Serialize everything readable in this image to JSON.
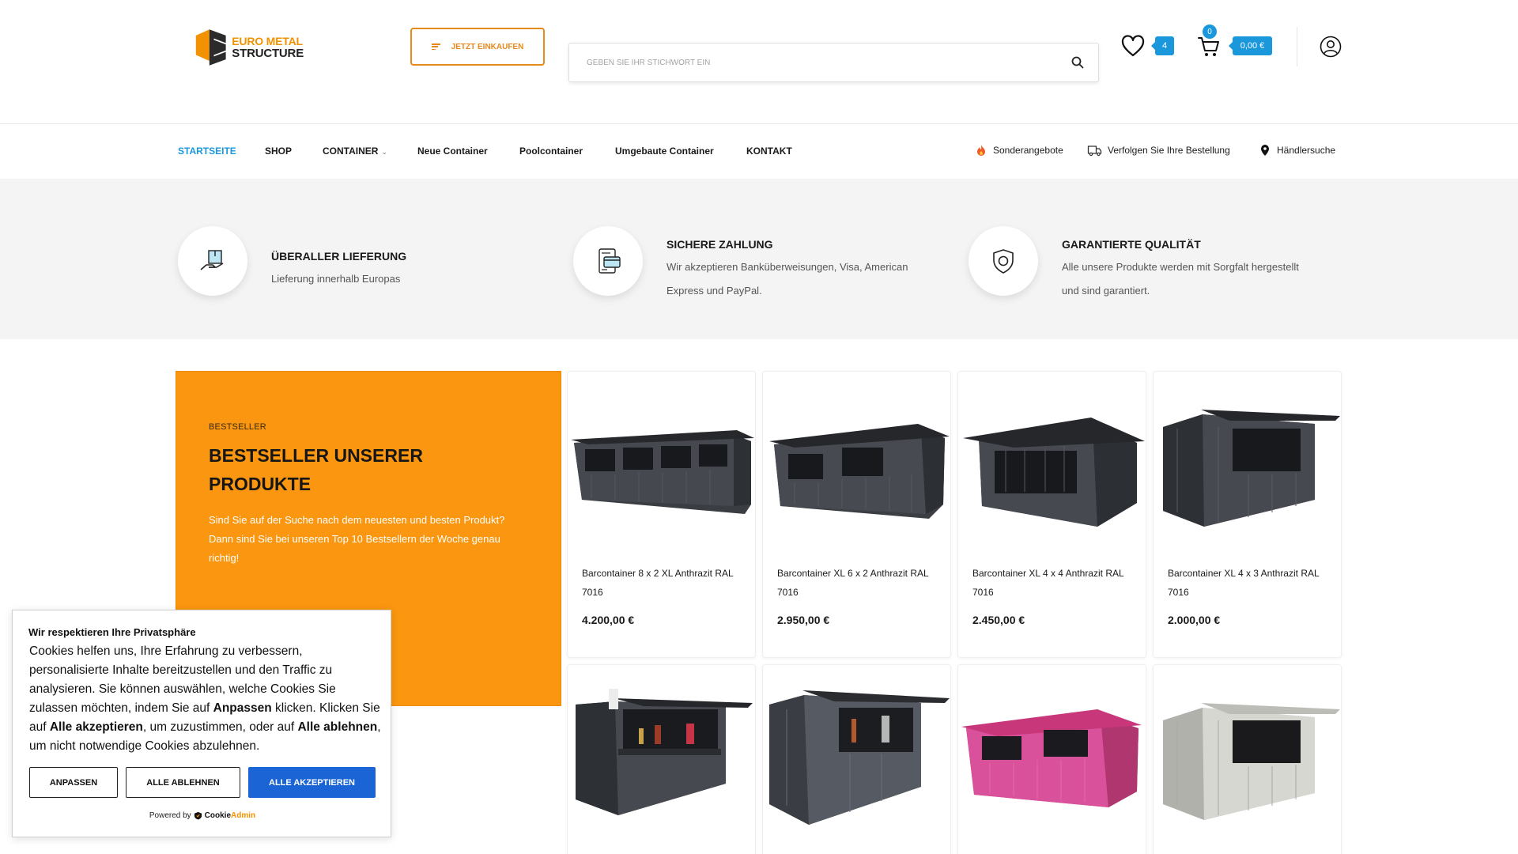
{
  "brand": {
    "line1_a": "EURO",
    "line1_b": "METAL",
    "line2": "STRUCTURE"
  },
  "header": {
    "shop_button": "JETZT EINKAUFEN",
    "search_placeholder": "GEBEN SIE IHR STICHWORT EIN",
    "wishlist_count": "4",
    "cart_count": "0",
    "cart_total": "0,00 €"
  },
  "nav": {
    "items": [
      {
        "label": "STARTSEITE"
      },
      {
        "label": "SHOP"
      },
      {
        "label": "CONTAINER"
      },
      {
        "label": "Neue Container"
      },
      {
        "label": "Poolcontainer"
      },
      {
        "label": "Umgebaute Container"
      },
      {
        "label": "KONTAKT"
      }
    ],
    "right": [
      {
        "label": "Sonderangebote"
      },
      {
        "label": "Verfolgen Sie Ihre Bestellung"
      },
      {
        "label": "Händlersuche"
      }
    ]
  },
  "features": [
    {
      "title": "ÜBERALLER LIEFERUNG",
      "desc": "Lieferung innerhalb Europas"
    },
    {
      "title": "SICHERE ZAHLUNG",
      "desc": "Wir akzeptieren Banküberweisungen, Visa, American Express und PayPal."
    },
    {
      "title": "GARANTIERTE QUALITÄT",
      "desc": "Alle unsere Produkte werden mit Sorgfalt hergestellt und sind garantiert."
    }
  ],
  "bestseller": {
    "kicker": "BESTSELLER",
    "title": "BESTSELLER UNSERER PRODUKTE",
    "desc": "Sind Sie auf der Suche nach dem neuesten und besten Produkt? Dann sind Sie bei unseren Top 10 Bestsellern der Woche genau richtig!"
  },
  "products": [
    {
      "name": "Barcontainer 8 x 2 XL Anthrazit RAL 7016",
      "price": "4.200,00 €"
    },
    {
      "name": "Barcontainer XL 6 x 2 Anthrazit RAL 7016",
      "price": "2.950,00 €"
    },
    {
      "name": "Barcontainer XL 4 x 4 Anthrazit RAL 7016",
      "price": "2.450,00 €"
    },
    {
      "name": "Barcontainer XL 4 x 3 Anthrazit RAL 7016",
      "price": "2.000,00 €"
    }
  ],
  "cookie": {
    "title": "Wir respektieren Ihre Privatsphäre",
    "text_1": "Cookies helfen uns, Ihre Erfahrung zu verbessern, personalisierte Inhalte bereitzustellen und den Traffic zu analysieren. Sie können auswählen, welche Cookies Sie zulassen möchten, indem Sie auf ",
    "text_b1": "Anpassen",
    "text_2": " klicken. Klicken Sie auf ",
    "text_b2": "Alle akzeptieren",
    "text_3": ", um zuzustimmen, oder auf ",
    "text_b3": "Alle ablehnen",
    "text_4": ", um nicht notwendige Cookies abzulehnen.",
    "btn_customize": "ANPASSEN",
    "btn_reject": "ALLE ABLEHNEN",
    "btn_accept": "ALLE AKZEPTIEREN",
    "powered_by": "Powered by",
    "powered_brand_a": "Cookie",
    "powered_brand_b": "Admin"
  },
  "colors": {
    "accent_blue": "#1b97dc",
    "accent_orange": "#fa960f",
    "button_blue": "#1a64d6"
  }
}
